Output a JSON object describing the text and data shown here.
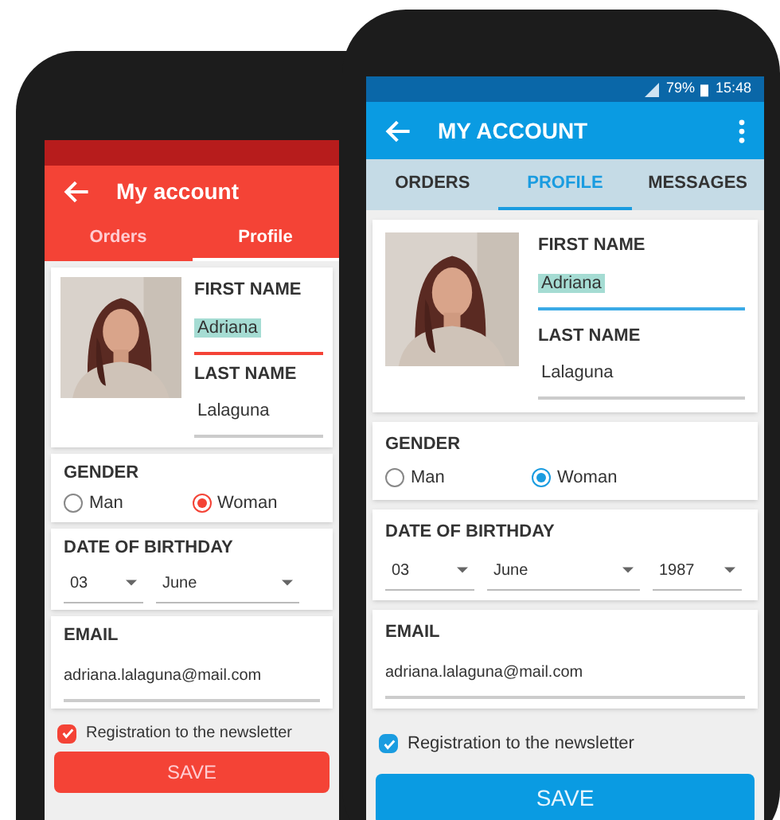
{
  "phones": [
    {
      "kind": "red",
      "title": "My account",
      "tabs": [
        {
          "label": "Orders",
          "selected": false
        },
        {
          "label": "Profile",
          "selected": true
        }
      ],
      "first_name": {
        "label": "FIRST NAME",
        "value": "Adriana",
        "focused": true
      },
      "last_name": {
        "label": "LAST NAME",
        "value": "Lalaguna",
        "focused": false
      },
      "gender": {
        "label": "GENDER",
        "options": [
          {
            "label": "Man",
            "selected": false
          },
          {
            "label": "Woman",
            "selected": true
          }
        ]
      },
      "birthday": {
        "label": "DATE OF BIRTHDAY",
        "fields": [
          "03",
          "June"
        ]
      },
      "email": {
        "label": "EMAIL",
        "value": "adriana.lalaguna@mail.com"
      },
      "newsletter": {
        "label": "Registration to the newsletter",
        "checked": true
      },
      "save": "SAVE"
    },
    {
      "kind": "blue",
      "status_bar": {
        "battery": "79%",
        "time": "15:48"
      },
      "title": "MY ACCOUNT",
      "tabs": [
        {
          "label": "ORDERS",
          "selected": false
        },
        {
          "label": "PROFILE",
          "selected": true
        },
        {
          "label": "MESSAGES",
          "selected": false
        }
      ],
      "first_name": {
        "label": "FIRST NAME",
        "value": "Adriana",
        "focused": true
      },
      "last_name": {
        "label": "LAST NAME",
        "value": "Lalaguna",
        "focused": false
      },
      "gender": {
        "label": "GENDER",
        "options": [
          {
            "label": "Man",
            "selected": false
          },
          {
            "label": "Woman",
            "selected": true
          }
        ]
      },
      "birthday": {
        "label": "DATE OF BIRTHDAY",
        "fields": [
          "03",
          "June",
          "1987"
        ]
      },
      "email": {
        "label": "EMAIL",
        "value": "adriana.lalaguna@mail.com"
      },
      "newsletter": {
        "label": "Registration to the newsletter",
        "checked": true
      },
      "save": "SAVE"
    }
  ]
}
